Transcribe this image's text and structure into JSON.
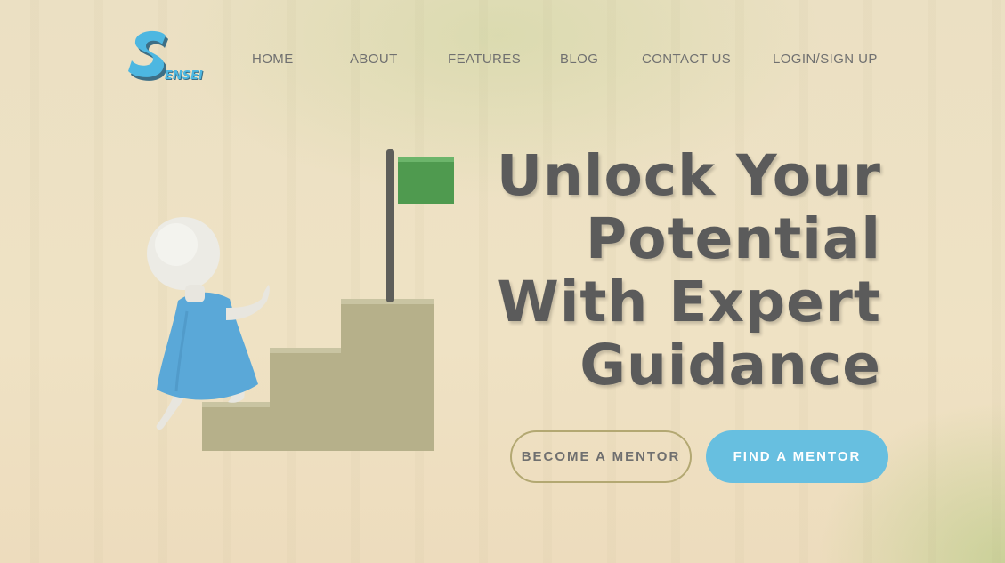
{
  "brand": {
    "logo_text": "Sensei",
    "logo_color": "#4db7e1"
  },
  "nav": {
    "items": [
      {
        "label": "HOME"
      },
      {
        "label": "ABOUT"
      },
      {
        "label": "FEATURES"
      },
      {
        "label": "BLOG"
      },
      {
        "label": "CONTACT US"
      },
      {
        "label": "LOGIN/SIGN UP"
      }
    ]
  },
  "hero": {
    "headline_lines": [
      "Unlock Your",
      "Potential",
      "With Expert",
      "Guidance"
    ],
    "buttons": {
      "become_mentor": "BECOME A MENTOR",
      "find_mentor": "FIND A MENTOR"
    },
    "illustration": "figure-climbing-stairs-to-flag"
  },
  "colors": {
    "accent": "#67bfe0",
    "text": "#5b5b5b",
    "outline": "#b3a872",
    "flag": "#4f9a4f"
  }
}
